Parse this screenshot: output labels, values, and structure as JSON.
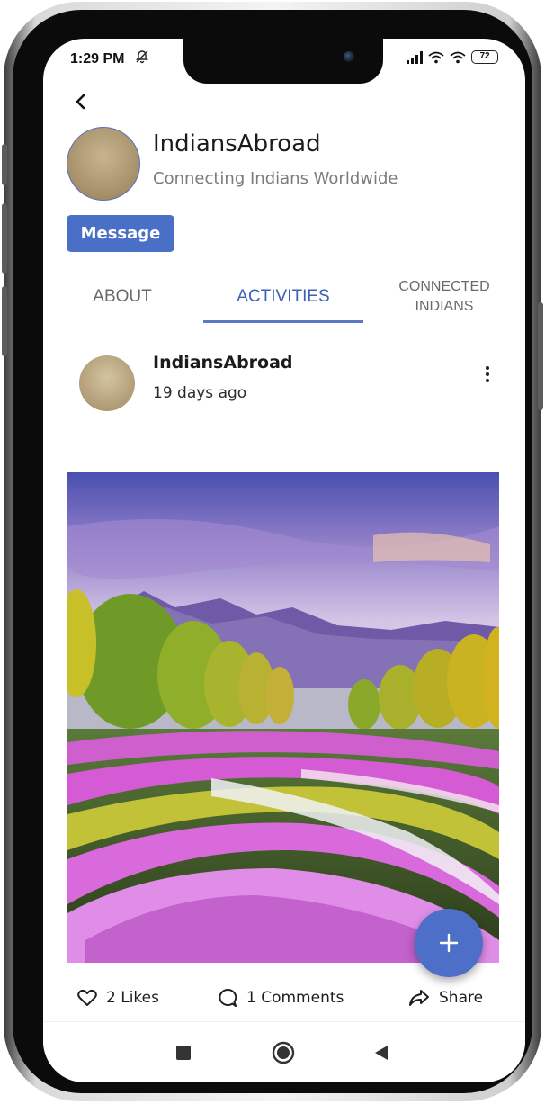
{
  "status_bar": {
    "time": "1:29 PM",
    "battery": "72"
  },
  "profile": {
    "name": "IndiansAbroad",
    "tagline": "Connecting Indians Worldwide",
    "message_label": "Message"
  },
  "tabs": [
    {
      "label": "ABOUT",
      "active": false
    },
    {
      "label": "ACTIVITIES",
      "active": true
    },
    {
      "label": "CONNECTED INDIANS",
      "active": false
    }
  ],
  "post": {
    "author": "IndiansAbroad",
    "time_ago": "19 days ago",
    "likes_label": "2 Likes",
    "comments_label": "1 Comments",
    "share_label": "Share"
  },
  "fab": {
    "symbol": "+"
  },
  "colors": {
    "accent": "#4a6fc6",
    "tab_active": "#3d5fb8",
    "tab_inactive": "#6a6a6a"
  },
  "icons": {
    "back": "chevron-left-icon",
    "more": "more-vertical-icon",
    "like": "heart-icon",
    "comment": "comment-icon",
    "share": "share-icon",
    "nav_recents": "square-icon",
    "nav_home": "circle-icon",
    "nav_back": "triangle-back-icon"
  }
}
